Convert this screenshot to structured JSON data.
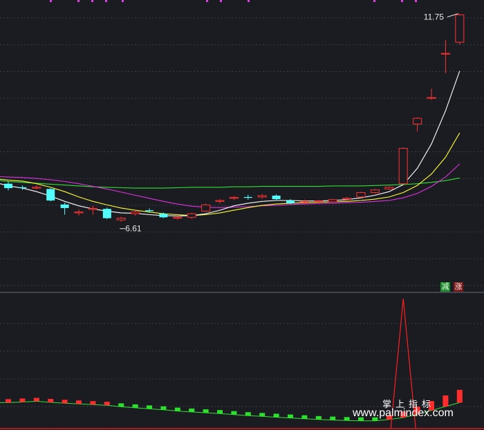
{
  "chart_data": [
    {
      "type": "candlestick",
      "panel": "price",
      "annotations": {
        "high_label": "11.75",
        "low_label": "6.61"
      },
      "legend": [
        {
          "label": "减",
          "color": "#1f8a2e"
        },
        {
          "label": "涨",
          "color": "#7a1b1b"
        }
      ],
      "colors": {
        "up": "#ff3232",
        "down": "#54ffff",
        "ma_white": "#ffffff",
        "ma_yellow": "#ffff33",
        "ma_magenta": "#e033e0",
        "ma_green": "#33e033",
        "grid": "#3a3d49"
      },
      "grid": true,
      "ylim": [
        5.8,
        11.9
      ],
      "candles": [
        {
          "o": 7.9,
          "c": 7.8,
          "h": 7.95,
          "l": 7.75
        },
        {
          "o": 7.82,
          "c": 7.8,
          "h": 7.86,
          "l": 7.76
        },
        {
          "o": 7.8,
          "c": 7.82,
          "h": 7.86,
          "l": 7.77
        },
        {
          "o": 7.78,
          "c": 7.52,
          "h": 7.8,
          "l": 7.5
        },
        {
          "o": 7.43,
          "c": 7.35,
          "h": 7.47,
          "l": 7.2
        },
        {
          "o": 7.24,
          "c": 7.26,
          "h": 7.32,
          "l": 7.18
        },
        {
          "o": 7.32,
          "c": 7.34,
          "h": 7.4,
          "l": 7.2
        },
        {
          "o": 7.33,
          "c": 7.12,
          "h": 7.36,
          "l": 7.1
        },
        {
          "o": 7.08,
          "c": 7.12,
          "h": 7.15,
          "l": 7.04
        },
        {
          "o": 7.22,
          "c": 7.26,
          "h": 7.3,
          "l": 7.18
        },
        {
          "o": 7.3,
          "c": 7.28,
          "h": 7.34,
          "l": 7.24
        },
        {
          "o": 7.22,
          "c": 7.14,
          "h": 7.25,
          "l": 7.12
        },
        {
          "o": 7.12,
          "c": 7.14,
          "h": 7.18,
          "l": 7.08
        },
        {
          "o": 7.14,
          "c": 7.22,
          "h": 7.24,
          "l": 7.1
        },
        {
          "o": 7.28,
          "c": 7.42,
          "h": 7.45,
          "l": 7.26
        },
        {
          "o": 7.5,
          "c": 7.52,
          "h": 7.55,
          "l": 7.45
        },
        {
          "o": 7.57,
          "c": 7.59,
          "h": 7.62,
          "l": 7.53
        },
        {
          "o": 7.6,
          "c": 7.58,
          "h": 7.65,
          "l": 7.54
        },
        {
          "o": 7.6,
          "c": 7.63,
          "h": 7.67,
          "l": 7.56
        },
        {
          "o": 7.63,
          "c": 7.55,
          "h": 7.66,
          "l": 7.52
        },
        {
          "o": 7.52,
          "c": 7.46,
          "h": 7.55,
          "l": 7.44
        },
        {
          "o": 7.5,
          "c": 7.5,
          "h": 7.54,
          "l": 7.44
        },
        {
          "o": 7.5,
          "c": 7.51,
          "h": 7.53,
          "l": 7.46
        },
        {
          "o": 7.49,
          "c": 7.54,
          "h": 7.56,
          "l": 7.47
        },
        {
          "o": 7.55,
          "c": 7.57,
          "h": 7.6,
          "l": 7.52
        },
        {
          "o": 7.6,
          "c": 7.7,
          "h": 7.72,
          "l": 7.58
        },
        {
          "o": 7.7,
          "c": 7.76,
          "h": 7.78,
          "l": 7.68
        },
        {
          "o": 7.78,
          "c": 7.82,
          "h": 7.84,
          "l": 7.76
        },
        {
          "o": 7.9,
          "c": 8.7,
          "h": 8.72,
          "l": 7.88
        },
        {
          "o": 9.25,
          "c": 9.38,
          "h": 9.4,
          "l": 9.08
        },
        {
          "o": 9.85,
          "c": 9.85,
          "h": 10.05,
          "l": 9.8
        },
        {
          "o": 10.85,
          "c": 10.85,
          "h": 11.15,
          "l": 10.4
        },
        {
          "o": 11.1,
          "c": 11.72,
          "h": 11.75,
          "l": 11.05
        }
      ],
      "ma_white": [
        7.85,
        7.8,
        7.72,
        7.62,
        7.5,
        7.4,
        7.33,
        7.28,
        7.24,
        7.23,
        7.2,
        7.18,
        7.17,
        7.18,
        7.22,
        7.3,
        7.4,
        7.46,
        7.5,
        7.52,
        7.52,
        7.51,
        7.51,
        7.52,
        7.54,
        7.58,
        7.64,
        7.72,
        7.88,
        8.25,
        8.8,
        9.55,
        10.45
      ],
      "ma_yellow": [
        7.98,
        7.96,
        7.9,
        7.82,
        7.72,
        7.6,
        7.5,
        7.42,
        7.35,
        7.3,
        7.26,
        7.22,
        7.2,
        7.18,
        7.2,
        7.24,
        7.3,
        7.36,
        7.41,
        7.44,
        7.46,
        7.47,
        7.48,
        7.49,
        7.5,
        7.52,
        7.55,
        7.6,
        7.7,
        7.86,
        8.12,
        8.5,
        9.05
      ],
      "ma_magenta": [
        8.05,
        8.04,
        8.02,
        7.99,
        7.95,
        7.9,
        7.84,
        7.78,
        7.71,
        7.64,
        7.57,
        7.5,
        7.44,
        7.39,
        7.37,
        7.36,
        7.37,
        7.38,
        7.4,
        7.41,
        7.43,
        7.44,
        7.45,
        7.46,
        7.47,
        7.48,
        7.5,
        7.52,
        7.58,
        7.68,
        7.84,
        8.05,
        8.35
      ],
      "ma_green": [
        7.95,
        7.93,
        7.91,
        7.89,
        7.87,
        7.85,
        7.83,
        7.82,
        7.81,
        7.8,
        7.8,
        7.8,
        7.81,
        7.82,
        7.82,
        7.82,
        7.83,
        7.83,
        7.84,
        7.84,
        7.84,
        7.84,
        7.84,
        7.85,
        7.85,
        7.85,
        7.86,
        7.87,
        7.88,
        7.9,
        7.93,
        7.97,
        8.03
      ]
    },
    {
      "type": "indicator",
      "panel": "lower",
      "ylim": [
        0,
        100
      ],
      "bars": [
        {
          "v": 20.0,
          "c": "#ff2d2d"
        },
        {
          "v": 20.5,
          "c": "#ff2d2d"
        },
        {
          "v": 21.0,
          "c": "#ff2d2d"
        },
        {
          "v": 20.2,
          "c": "#ff2d2d"
        },
        {
          "v": 19.5,
          "c": "#ff2d2d"
        },
        {
          "v": 19.0,
          "c": "#ff2d2d"
        },
        {
          "v": 18.5,
          "c": "#ff2d2d"
        },
        {
          "v": 18.0,
          "c": "#ff2d2d"
        },
        {
          "v": 16.8,
          "c": "#2de02d"
        },
        {
          "v": 16.0,
          "c": "#2de02d"
        },
        {
          "v": 15.2,
          "c": "#2de02d"
        },
        {
          "v": 14.5,
          "c": "#2de02d"
        },
        {
          "v": 13.5,
          "c": "#2de02d"
        },
        {
          "v": 12.8,
          "c": "#2de02d"
        },
        {
          "v": 12.2,
          "c": "#2de02d"
        },
        {
          "v": 11.6,
          "c": "#2de02d"
        },
        {
          "v": 10.8,
          "c": "#2de02d"
        },
        {
          "v": 10.0,
          "c": "#2de02d"
        },
        {
          "v": 9.4,
          "c": "#2de02d"
        },
        {
          "v": 8.8,
          "c": "#2de02d"
        },
        {
          "v": 8.2,
          "c": "#2de02d"
        },
        {
          "v": 7.6,
          "c": "#2de02d"
        },
        {
          "v": 7.0,
          "c": "#2de02d"
        },
        {
          "v": 6.6,
          "c": "#2de02d"
        },
        {
          "v": 6.2,
          "c": "#2de02d"
        },
        {
          "v": 6.0,
          "c": "#2de02d"
        },
        {
          "v": 6.0,
          "c": "#2de02d"
        },
        {
          "v": 7.0,
          "c": "#ff2d2d"
        },
        {
          "v": 8.5,
          "c": "#ff2d2d"
        },
        {
          "v": 11.0,
          "c": "#ff2d2d"
        },
        {
          "v": 14.0,
          "c": "#ff2d2d"
        },
        {
          "v": 17.0,
          "c": "#ff2d2d"
        },
        {
          "v": 20.0,
          "c": "#ff2d2d"
        }
      ],
      "spike": {
        "index": 28,
        "peak": 100,
        "color": "#ff2020"
      }
    }
  ],
  "watermark": {
    "title": "掌上指标",
    "url": "www.palmindex.com"
  }
}
